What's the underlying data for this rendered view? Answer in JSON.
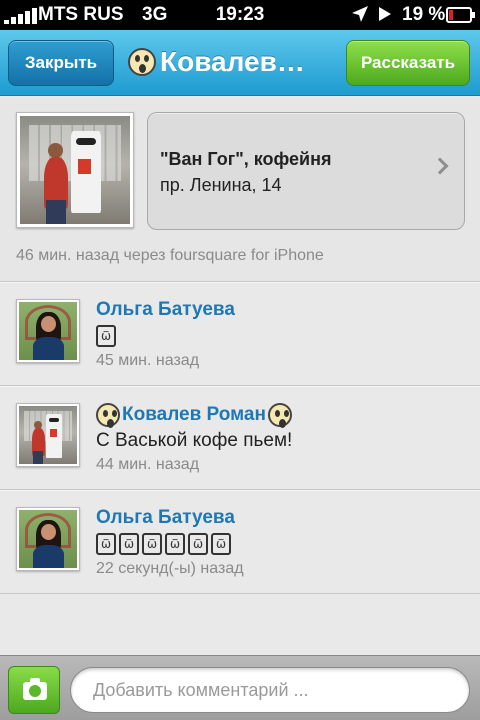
{
  "status_bar": {
    "carrier": "MTS RUS",
    "network": "3G",
    "time": "19:23",
    "battery_percent": "19 %",
    "battery_level": 0.19,
    "battery_color": "#e02020",
    "location_icon": "location-arrow-icon",
    "play_icon": "play-icon"
  },
  "nav": {
    "close_label": "Закрыть",
    "title": "Ковалев…",
    "title_emoji": "scream-emoji-icon",
    "share_label": "Рассказать",
    "close_color": "#1b86bf",
    "share_color": "#6cc835"
  },
  "checkin": {
    "venue_name": "\"Ван Гог\", кофейня",
    "venue_address": "пр. Ленина, 14",
    "meta": "46 мин. назад через foursquare for iPhone"
  },
  "comments": [
    {
      "author": "Ольга Батуева",
      "text_glyphs": [
        "ѿ"
      ],
      "time": "45 мин. назад",
      "avatar": "girl"
    },
    {
      "author": "Ковалев Роман",
      "author_emoji": "scream-emoji-icon",
      "text": "С Васькой кофе пьем!",
      "time": "44 мин. назад",
      "avatar": "robot"
    },
    {
      "author": "Ольга Батуева",
      "text_glyphs": [
        "ѿ",
        "ѿ",
        "ѿ",
        "ѿ",
        "ѿ",
        "ѿ"
      ],
      "time": "22 секунд(-ы) назад",
      "avatar": "girl"
    }
  ],
  "composer": {
    "placeholder": "Добавить комментарий ...",
    "camera_icon": "camera-icon"
  }
}
